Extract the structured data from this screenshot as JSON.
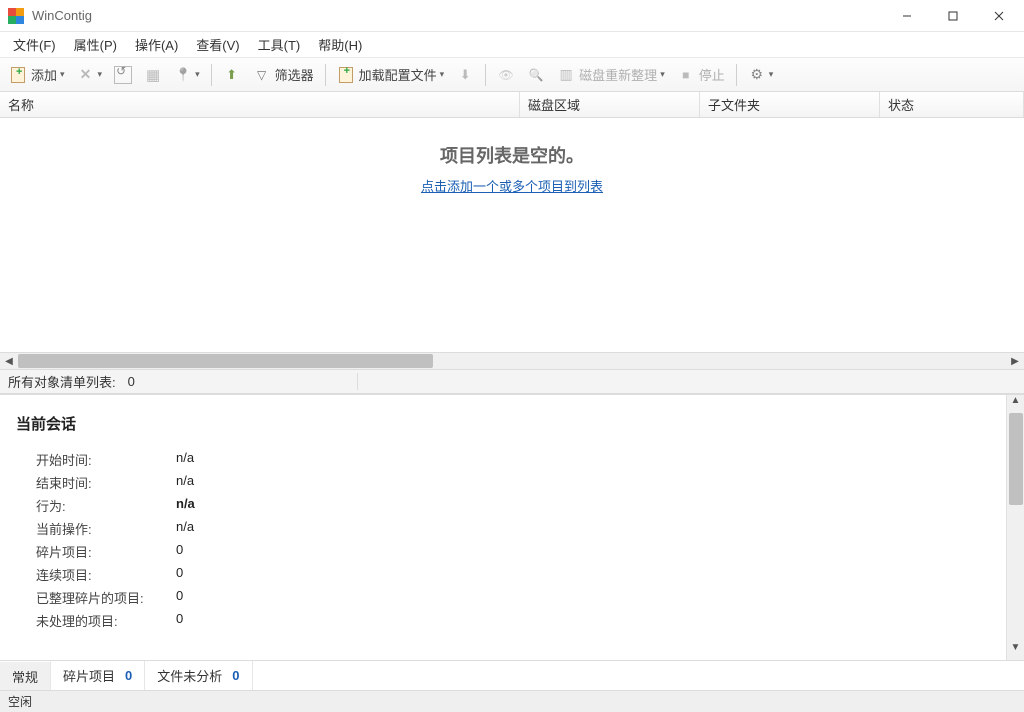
{
  "window": {
    "title": "WinContig"
  },
  "menu": {
    "file": "文件(F)",
    "props": "属性(P)",
    "ops": "操作(A)",
    "view": "查看(V)",
    "tools": "工具(T)",
    "help": "帮助(H)"
  },
  "toolbar": {
    "add": "添加",
    "filter": "筛选器",
    "loadprofile": "加载配置文件",
    "defrag": "磁盘重新整理",
    "stop": "停止"
  },
  "columns": {
    "name": "名称",
    "disk": "磁盘区域",
    "sub": "子文件夹",
    "state": "状态"
  },
  "empty": {
    "title": "项目列表是空的。",
    "link": "点击添加一个或多个项目到列表"
  },
  "countbar": {
    "label": "所有对象清单列表:",
    "value": "0"
  },
  "session": {
    "title": "当前会话",
    "start_time_k": "开始时间:",
    "start_time_v": "n/a",
    "end_time_k": "结束时间:",
    "end_time_v": "n/a",
    "action_k": "行为:",
    "action_v": "n/a",
    "current_op_k": "当前操作:",
    "current_op_v": "n/a",
    "frag_items_k": "碎片项目:",
    "frag_items_v": "0",
    "cont_items_k": "连续项目:",
    "cont_items_v": "0",
    "defrag_done_k": "已整理碎片的项目:",
    "defrag_done_v": "0",
    "unproc_k": "未处理的项目:",
    "unproc_v": "0"
  },
  "tabs": {
    "general": "常规",
    "frag": "碎片项目",
    "frag_badge": "0",
    "unanalyzed": "文件未分析",
    "unanalyzed_badge": "0"
  },
  "status": {
    "text": "空闲"
  }
}
